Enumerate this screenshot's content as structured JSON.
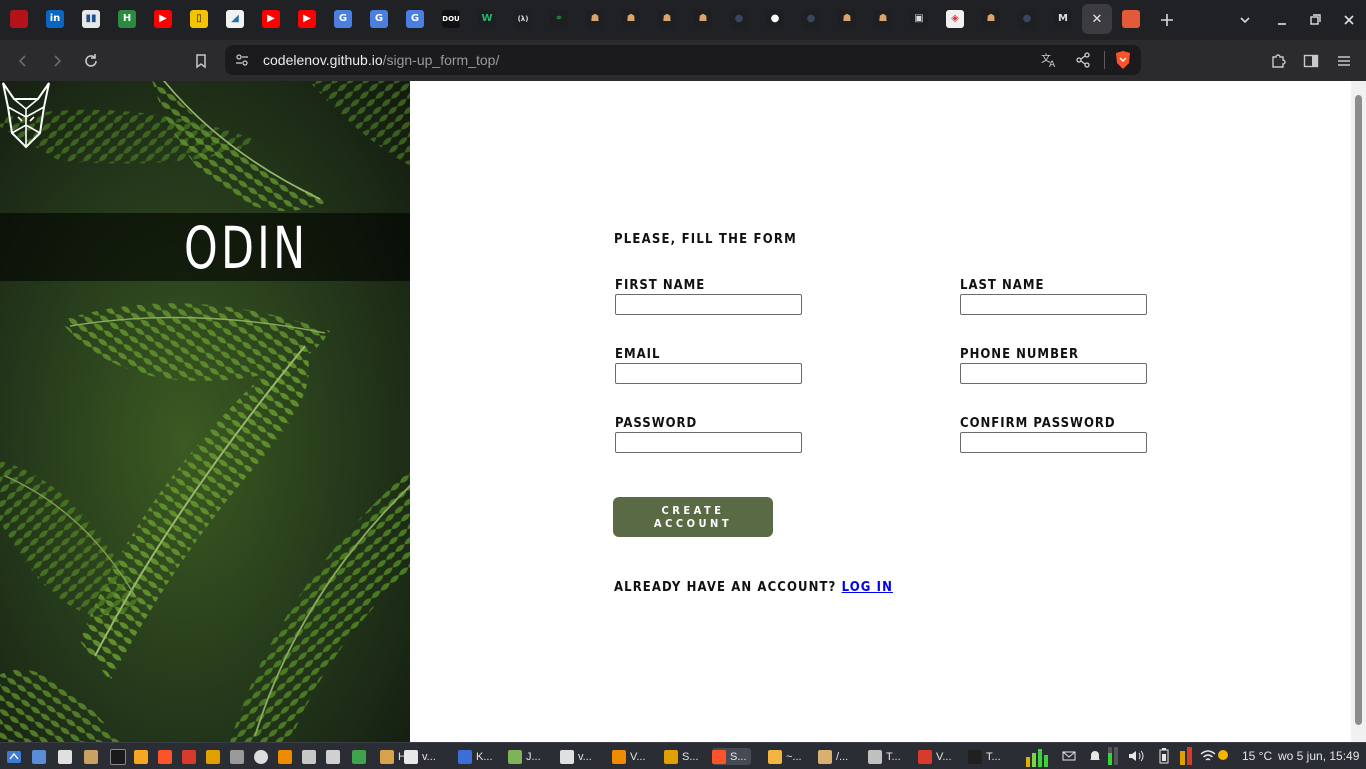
{
  "browser": {
    "url_host": "codelenov.github.io",
    "url_path": "/sign-up_form_top/",
    "tabs": [
      {
        "icon": "app-icon",
        "label": "",
        "color": "#b3121b",
        "fg": "#fff"
      },
      {
        "icon": "linkedin-icon",
        "label": "in",
        "color": "#0a66c2",
        "fg": "#fff"
      },
      {
        "icon": "trello-icon",
        "label": "▮▮",
        "color": "#e8e8e8",
        "fg": "#1f4f8f"
      },
      {
        "icon": "h-icon",
        "label": "H",
        "color": "#2a8a3d",
        "fg": "#fff"
      },
      {
        "icon": "youtube-icon",
        "label": "▶",
        "color": "#ff0000",
        "fg": "#fff"
      },
      {
        "icon": "note-icon",
        "label": "▯",
        "color": "#f5c400",
        "fg": "#111"
      },
      {
        "icon": "doc-icon",
        "label": "◢",
        "color": "#f2f2f2",
        "fg": "#2c6cb0"
      },
      {
        "icon": "youtube-icon",
        "label": "▶",
        "color": "#ff0000",
        "fg": "#fff"
      },
      {
        "icon": "youtube-icon",
        "label": "▶",
        "color": "#ff0000",
        "fg": "#fff"
      },
      {
        "icon": "translate-icon",
        "label": "G",
        "color": "#4a7fe0",
        "fg": "#fff"
      },
      {
        "icon": "translate-icon",
        "label": "G",
        "color": "#4a7fe0",
        "fg": "#fff"
      },
      {
        "icon": "translate-icon",
        "label": "G",
        "color": "#4a7fe0",
        "fg": "#fff"
      },
      {
        "icon": "dou-icon",
        "label": "DOU",
        "color": "#111111",
        "fg": "#fff"
      },
      {
        "icon": "w-icon",
        "label": "W",
        "color": "#1d1f22",
        "fg": "#27b46e"
      },
      {
        "icon": "lambda-icon",
        "label": "(λ)",
        "color": "#1d1f22",
        "fg": "#ddd"
      },
      {
        "icon": "geeks-icon",
        "label": "⚭",
        "color": "#1d1f22",
        "fg": "#2f8d46"
      },
      {
        "icon": "odin-icon",
        "label": "☗",
        "color": "#1d1f22",
        "fg": "#d9a46b"
      },
      {
        "icon": "odin-icon",
        "label": "☗",
        "color": "#1d1f22",
        "fg": "#d9a46b"
      },
      {
        "icon": "odin-icon",
        "label": "☗",
        "color": "#1d1f22",
        "fg": "#d9a46b"
      },
      {
        "icon": "odin-icon",
        "label": "☗",
        "color": "#1d1f22",
        "fg": "#d9a46b"
      },
      {
        "icon": "globe-icon",
        "label": "●",
        "color": "#1d1f22",
        "fg": "#3a4660"
      },
      {
        "icon": "github-icon",
        "label": "●",
        "color": "#1d1f22",
        "fg": "#ffffff"
      },
      {
        "icon": "globe-icon",
        "label": "●",
        "color": "#1d1f22",
        "fg": "#3a4660"
      },
      {
        "icon": "odin-icon",
        "label": "☗",
        "color": "#1d1f22",
        "fg": "#d9a46b"
      },
      {
        "icon": "odin-icon",
        "label": "☗",
        "color": "#1d1f22",
        "fg": "#d9a46b"
      },
      {
        "icon": "bookmark-icon",
        "label": "▣",
        "color": "#1d1f22",
        "fg": "#ddd"
      },
      {
        "icon": "cube-icon",
        "label": "◈",
        "color": "#f0f0f0",
        "fg": "#d33"
      },
      {
        "icon": "odin-icon",
        "label": "☗",
        "color": "#1d1f22",
        "fg": "#d9a46b"
      },
      {
        "icon": "globe-icon",
        "label": "●",
        "color": "#1d1f22",
        "fg": "#3a4660"
      },
      {
        "icon": "medium-icon",
        "label": "M",
        "color": "#1d1f22",
        "fg": "#ddd"
      },
      {
        "icon": "close-icon",
        "label": "✕",
        "color": "transparent",
        "fg": "#e8e8e8",
        "active": true
      }
    ]
  },
  "page": {
    "brand": "ODIN",
    "heading": "Please, fill the form",
    "fields": [
      {
        "label": "First Name",
        "value": ""
      },
      {
        "label": "Last Name",
        "value": ""
      },
      {
        "label": "Email",
        "value": ""
      },
      {
        "label": "Phone Number",
        "value": ""
      },
      {
        "label": "Password",
        "value": ""
      },
      {
        "label": "Confirm Password",
        "value": ""
      }
    ],
    "create_button": "Create Account",
    "login_prompt": "Already have an account?",
    "login_link": "Log in"
  },
  "taskbar": {
    "tasks": [
      {
        "label": "H...",
        "color": "#d8a24a"
      },
      {
        "label": "v...",
        "color": "#e8e8e8"
      },
      {
        "label": "K...",
        "color": "#3a6fd8"
      },
      {
        "label": "J...",
        "color": "#7fb35a"
      },
      {
        "label": "v...",
        "color": "#e0e0e0"
      },
      {
        "label": "V...",
        "color": "#f08a00"
      },
      {
        "label": "S...",
        "color": "#e0a000"
      },
      {
        "label": "S...",
        "color": "#fb542b",
        "active": true
      },
      {
        "label": "~...",
        "color": "#f5b341"
      },
      {
        "label": "/...",
        "color": "#d9b070"
      },
      {
        "label": "T...",
        "color": "#c0c0c0"
      },
      {
        "label": "V...",
        "color": "#d93a2b"
      },
      {
        "label": "T...",
        "color": "#202020"
      }
    ],
    "temperature": "15 °C",
    "clock": "wo  5 jun, 15:49"
  }
}
